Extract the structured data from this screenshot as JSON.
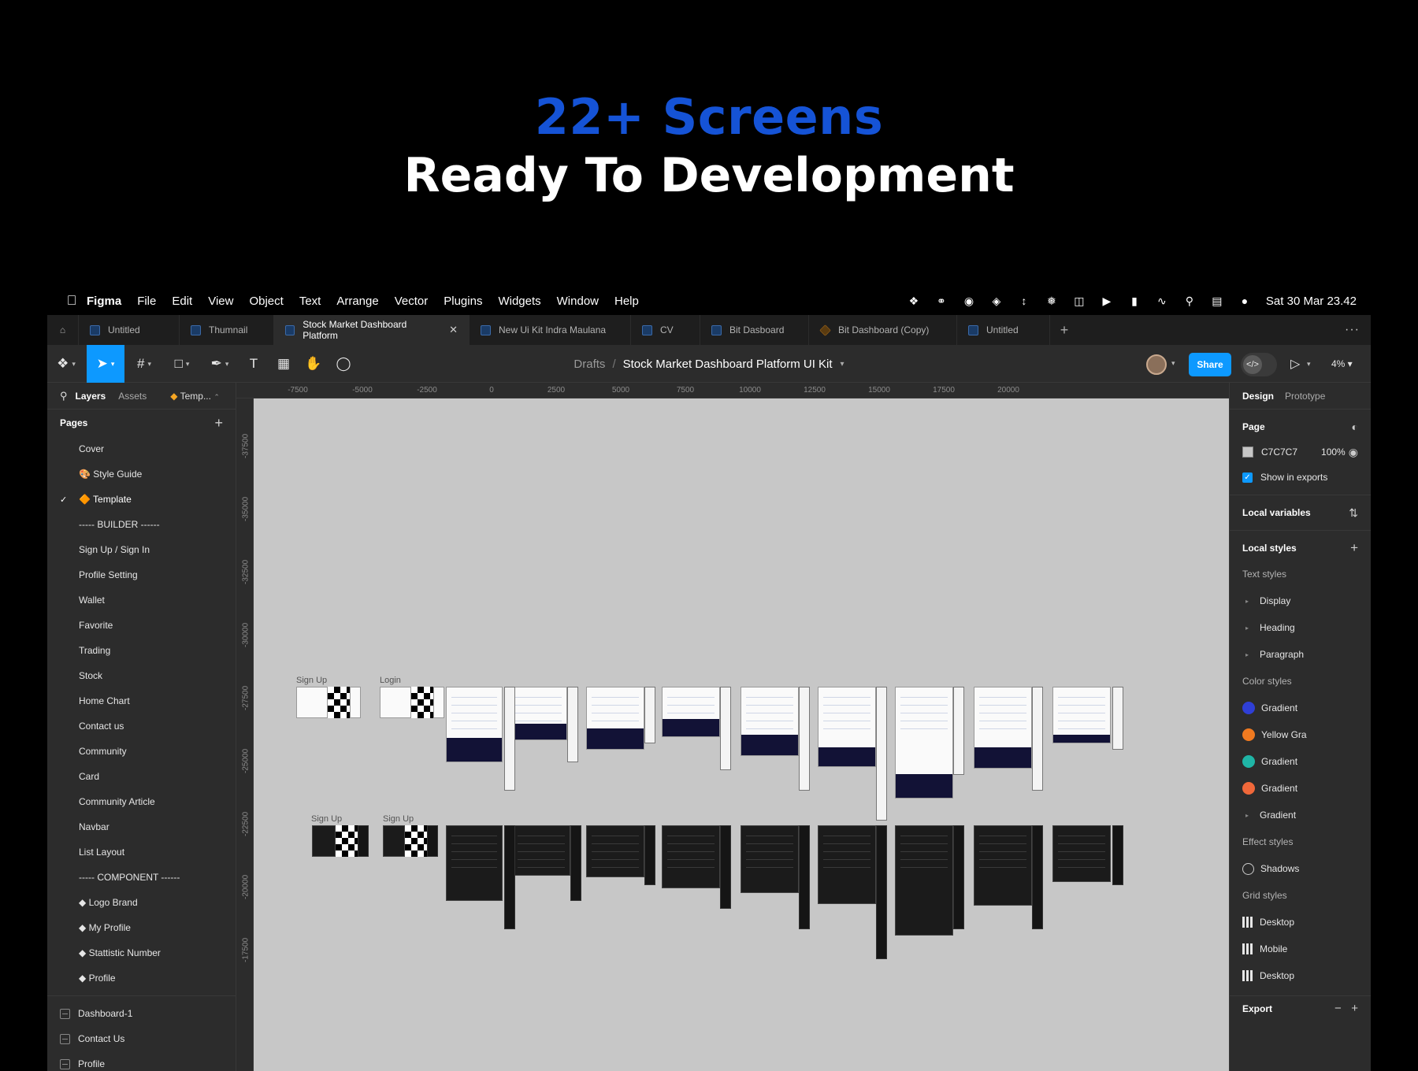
{
  "hero": {
    "line1": "22+ Screens",
    "line2": "Ready To Development"
  },
  "menubar": {
    "apple_icon": "apple-icon",
    "app_name": "Figma",
    "items": [
      "File",
      "Edit",
      "View",
      "Object",
      "Text",
      "Arrange",
      "Vector",
      "Plugins",
      "Widgets",
      "Window",
      "Help"
    ],
    "status_icons": [
      "figma-icon",
      "creative-cloud-icon",
      "grammarly-icon",
      "layers-icon",
      "resize-icon",
      "fan-icon",
      "car-icon",
      "play-icon",
      "battery-icon",
      "wifi-icon",
      "search-icon",
      "control-center-icon",
      "siri-icon"
    ],
    "datetime": "Sat 30 Mar  23.42"
  },
  "tabs": [
    {
      "label": "Untitled",
      "active": false
    },
    {
      "label": "Thumnail",
      "active": false
    },
    {
      "label": "Stock Market Dashboard Platform",
      "active": true
    },
    {
      "label": "New Ui Kit Indra Maulana",
      "active": false
    },
    {
      "label": "CV",
      "active": false
    },
    {
      "label": "Bit Dasboard",
      "active": false
    },
    {
      "label": "Bit Dashboard (Copy)",
      "active": false
    },
    {
      "label": "Untitled",
      "active": false
    }
  ],
  "toolbar": {
    "breadcrumb_drafts": "Drafts",
    "breadcrumb_sep": "/",
    "file_name": "Stock Market Dashboard Platform UI Kit",
    "share_label": "Share",
    "zoom": "4%",
    "accent": "#0d99ff"
  },
  "left_panel": {
    "tab_layers": "Layers",
    "tab_assets": "Assets",
    "page_selector": "Temp...",
    "pages_header": "Pages",
    "pages": [
      {
        "label": "Cover",
        "active": false
      },
      {
        "label": "🎨 Style Guide",
        "active": false
      },
      {
        "label": "🔶 Template",
        "active": true
      },
      {
        "label": "----- BUILDER ------",
        "active": false
      },
      {
        "label": "Sign Up / Sign In",
        "active": false
      },
      {
        "label": "Profile Setting",
        "active": false
      },
      {
        "label": "Wallet",
        "active": false
      },
      {
        "label": "Favorite",
        "active": false
      },
      {
        "label": "Trading",
        "active": false
      },
      {
        "label": "Stock",
        "active": false
      },
      {
        "label": "Home Chart",
        "active": false
      },
      {
        "label": "Contact us",
        "active": false
      },
      {
        "label": "Community",
        "active": false
      },
      {
        "label": "Card",
        "active": false
      },
      {
        "label": "Community Article",
        "active": false
      },
      {
        "label": "Navbar",
        "active": false
      },
      {
        "label": "List Layout",
        "active": false
      },
      {
        "label": "----- COMPONENT ------",
        "active": false
      },
      {
        "label": "◆ Logo Brand",
        "active": false
      },
      {
        "label": "◆ My Profile",
        "active": false
      },
      {
        "label": "◆  Stattistic Number",
        "active": false
      },
      {
        "label": "◆ Profile",
        "active": false
      }
    ],
    "layers": [
      "Dashboard-1",
      "Contact Us",
      "Profile"
    ]
  },
  "canvas": {
    "background": "#c7c7c7",
    "ruler_top": [
      "-7500",
      "-5000",
      "-2500",
      "0",
      "2500",
      "5000",
      "7500",
      "10000",
      "12500",
      "15000",
      "17500",
      "20000"
    ],
    "ruler_left": [
      "-37500",
      "-35000",
      "-32500",
      "-30000",
      "-27500",
      "-25000",
      "-22500",
      "-20000",
      "-17500"
    ],
    "frame_labels_row1": [
      "Sign Up",
      "Login"
    ],
    "frame_labels_row2": [
      "Sign Up",
      "Sign Up"
    ],
    "frame_menu": "..."
  },
  "right_panel": {
    "tab_design": "Design",
    "tab_prototype": "Prototype",
    "page_title": "Page",
    "page_color": "C7C7C7",
    "page_opacity": "100%",
    "show_in_exports": "Show in exports",
    "local_variables": "Local variables",
    "local_styles": "Local styles",
    "text_styles_label": "Text styles",
    "text_styles": [
      "Display",
      "Heading",
      "Paragraph"
    ],
    "color_styles_label": "Color styles",
    "color_styles": [
      {
        "name": "Gradient",
        "color": "#2f3fd6"
      },
      {
        "name": "Yellow Gra",
        "color": "#f07a20"
      },
      {
        "name": "Gradient",
        "color": "#1fb5a6"
      },
      {
        "name": "Gradient",
        "color": "#f0683a"
      },
      {
        "name": "Gradient",
        "color": ""
      }
    ],
    "effect_styles_label": "Effect styles",
    "effect_styles": [
      "Shadows"
    ],
    "grid_styles_label": "Grid styles",
    "grid_styles": [
      "Desktop",
      "Mobile",
      "Desktop"
    ],
    "export_label": "Export"
  }
}
